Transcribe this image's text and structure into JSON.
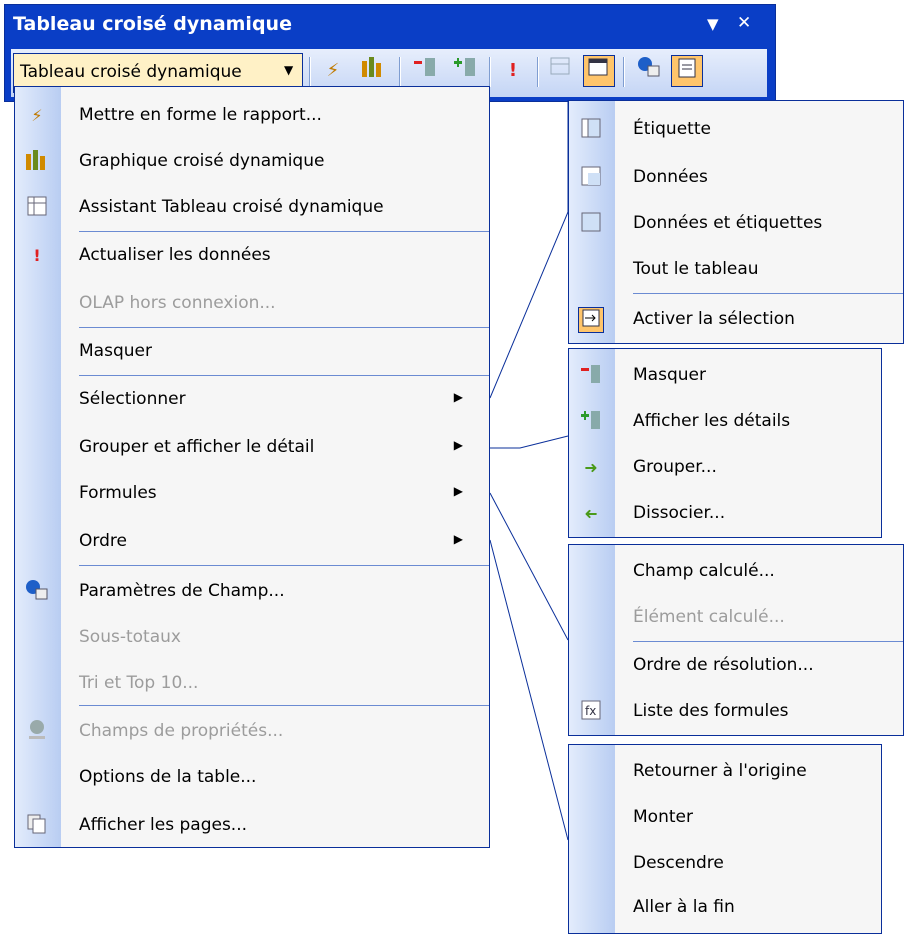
{
  "toolbar": {
    "title": "Tableau croisé dynamique",
    "menu_button": "Tableau croisé dynamique",
    "dropdown_arrow": "▼",
    "close": "✕"
  },
  "main_menu": {
    "items": [
      {
        "label": "Mettre en forme le rapport...",
        "icon": "format-report-icon",
        "enabled": true
      },
      {
        "label": "Graphique croisé dynamique",
        "icon": "pivot-chart-icon",
        "enabled": true
      },
      {
        "label": "Assistant Tableau croisé dynamique",
        "icon": "pivot-wizard-icon",
        "enabled": true
      },
      {
        "label": "Actualiser les données",
        "icon": "refresh-icon",
        "enabled": true
      },
      {
        "label": "OLAP hors connexion...",
        "icon": "",
        "enabled": false
      },
      {
        "label": "Masquer",
        "icon": "",
        "enabled": true
      },
      {
        "label": "Sélectionner",
        "icon": "",
        "enabled": true,
        "submenu": true
      },
      {
        "label": "Grouper et afficher le détail",
        "icon": "",
        "enabled": true,
        "submenu": true
      },
      {
        "label": "Formules",
        "icon": "",
        "enabled": true,
        "submenu": true
      },
      {
        "label": "Ordre",
        "icon": "",
        "enabled": true,
        "submenu": true
      },
      {
        "label": "Paramètres de Champ...",
        "icon": "field-settings-icon",
        "enabled": true
      },
      {
        "label": "Sous-totaux",
        "icon": "",
        "enabled": false
      },
      {
        "label": "Tri et Top 10...",
        "icon": "",
        "enabled": false
      },
      {
        "label": "Champs de propriétés...",
        "icon": "property-fields-icon",
        "enabled": false
      },
      {
        "label": "Options de la table...",
        "icon": "",
        "enabled": true
      },
      {
        "label": "Afficher les pages...",
        "icon": "show-pages-icon",
        "enabled": true
      }
    ]
  },
  "submenu_select": {
    "items": [
      {
        "label": "Étiquette",
        "icon": "label-select-icon"
      },
      {
        "label": "Données",
        "icon": "data-select-icon"
      },
      {
        "label": "Données et étiquettes",
        "icon": "data-label-select-icon"
      },
      {
        "label": "Tout le tableau",
        "icon": ""
      },
      {
        "label": "Activer la sélection",
        "icon": "enable-selection-icon"
      }
    ]
  },
  "submenu_group": {
    "items": [
      {
        "label": "Masquer",
        "icon": "hide-detail-icon"
      },
      {
        "label": "Afficher les détails",
        "icon": "show-detail-icon"
      },
      {
        "label": "Grouper...",
        "icon": "group-icon"
      },
      {
        "label": "Dissocier...",
        "icon": "ungroup-icon"
      }
    ]
  },
  "submenu_formulas": {
    "items": [
      {
        "label": "Champ calculé...",
        "icon": "",
        "enabled": true
      },
      {
        "label": "Élément calculé...",
        "icon": "",
        "enabled": false
      },
      {
        "label": "Ordre de résolution...",
        "icon": "",
        "enabled": true
      },
      {
        "label": "Liste des formules",
        "icon": "formula-list-icon",
        "enabled": true
      }
    ]
  },
  "submenu_order": {
    "items": [
      {
        "label": "Retourner à l'origine"
      },
      {
        "label": "Monter"
      },
      {
        "label": "Descendre"
      },
      {
        "label": "Aller à la fin"
      }
    ]
  },
  "colors": {
    "title_bar": "#0a3ec6",
    "border": "#0a2f9a",
    "highlight": "#ffc56b",
    "disabled": "#9c9c9c"
  }
}
